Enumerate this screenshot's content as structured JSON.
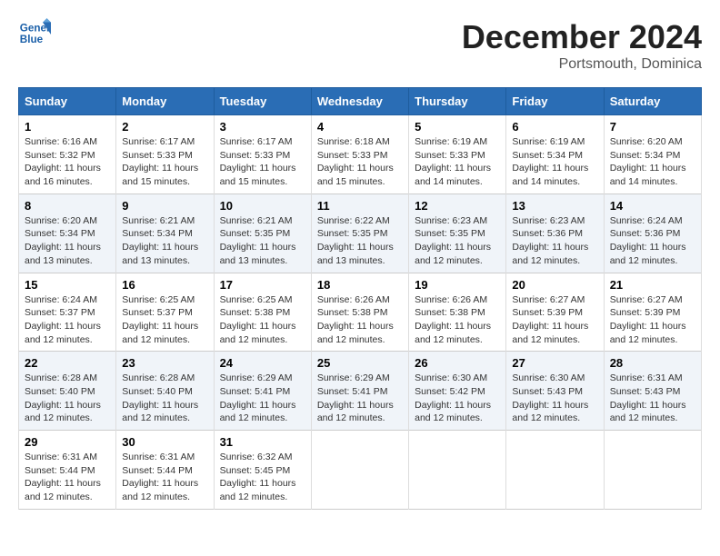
{
  "header": {
    "logo_line1": "General",
    "logo_line2": "Blue",
    "month": "December 2024",
    "location": "Portsmouth, Dominica"
  },
  "weekdays": [
    "Sunday",
    "Monday",
    "Tuesday",
    "Wednesday",
    "Thursday",
    "Friday",
    "Saturday"
  ],
  "weeks": [
    [
      {
        "day": 1,
        "sunrise": "6:16 AM",
        "sunset": "5:32 PM",
        "daylight": "11 hours and 16 minutes."
      },
      {
        "day": 2,
        "sunrise": "6:17 AM",
        "sunset": "5:33 PM",
        "daylight": "11 hours and 15 minutes."
      },
      {
        "day": 3,
        "sunrise": "6:17 AM",
        "sunset": "5:33 PM",
        "daylight": "11 hours and 15 minutes."
      },
      {
        "day": 4,
        "sunrise": "6:18 AM",
        "sunset": "5:33 PM",
        "daylight": "11 hours and 15 minutes."
      },
      {
        "day": 5,
        "sunrise": "6:19 AM",
        "sunset": "5:33 PM",
        "daylight": "11 hours and 14 minutes."
      },
      {
        "day": 6,
        "sunrise": "6:19 AM",
        "sunset": "5:34 PM",
        "daylight": "11 hours and 14 minutes."
      },
      {
        "day": 7,
        "sunrise": "6:20 AM",
        "sunset": "5:34 PM",
        "daylight": "11 hours and 14 minutes."
      }
    ],
    [
      {
        "day": 8,
        "sunrise": "6:20 AM",
        "sunset": "5:34 PM",
        "daylight": "11 hours and 13 minutes."
      },
      {
        "day": 9,
        "sunrise": "6:21 AM",
        "sunset": "5:34 PM",
        "daylight": "11 hours and 13 minutes."
      },
      {
        "day": 10,
        "sunrise": "6:21 AM",
        "sunset": "5:35 PM",
        "daylight": "11 hours and 13 minutes."
      },
      {
        "day": 11,
        "sunrise": "6:22 AM",
        "sunset": "5:35 PM",
        "daylight": "11 hours and 13 minutes."
      },
      {
        "day": 12,
        "sunrise": "6:23 AM",
        "sunset": "5:35 PM",
        "daylight": "11 hours and 12 minutes."
      },
      {
        "day": 13,
        "sunrise": "6:23 AM",
        "sunset": "5:36 PM",
        "daylight": "11 hours and 12 minutes."
      },
      {
        "day": 14,
        "sunrise": "6:24 AM",
        "sunset": "5:36 PM",
        "daylight": "11 hours and 12 minutes."
      }
    ],
    [
      {
        "day": 15,
        "sunrise": "6:24 AM",
        "sunset": "5:37 PM",
        "daylight": "11 hours and 12 minutes."
      },
      {
        "day": 16,
        "sunrise": "6:25 AM",
        "sunset": "5:37 PM",
        "daylight": "11 hours and 12 minutes."
      },
      {
        "day": 17,
        "sunrise": "6:25 AM",
        "sunset": "5:38 PM",
        "daylight": "11 hours and 12 minutes."
      },
      {
        "day": 18,
        "sunrise": "6:26 AM",
        "sunset": "5:38 PM",
        "daylight": "11 hours and 12 minutes."
      },
      {
        "day": 19,
        "sunrise": "6:26 AM",
        "sunset": "5:38 PM",
        "daylight": "11 hours and 12 minutes."
      },
      {
        "day": 20,
        "sunrise": "6:27 AM",
        "sunset": "5:39 PM",
        "daylight": "11 hours and 12 minutes."
      },
      {
        "day": 21,
        "sunrise": "6:27 AM",
        "sunset": "5:39 PM",
        "daylight": "11 hours and 12 minutes."
      }
    ],
    [
      {
        "day": 22,
        "sunrise": "6:28 AM",
        "sunset": "5:40 PM",
        "daylight": "11 hours and 12 minutes."
      },
      {
        "day": 23,
        "sunrise": "6:28 AM",
        "sunset": "5:40 PM",
        "daylight": "11 hours and 12 minutes."
      },
      {
        "day": 24,
        "sunrise": "6:29 AM",
        "sunset": "5:41 PM",
        "daylight": "11 hours and 12 minutes."
      },
      {
        "day": 25,
        "sunrise": "6:29 AM",
        "sunset": "5:41 PM",
        "daylight": "11 hours and 12 minutes."
      },
      {
        "day": 26,
        "sunrise": "6:30 AM",
        "sunset": "5:42 PM",
        "daylight": "11 hours and 12 minutes."
      },
      {
        "day": 27,
        "sunrise": "6:30 AM",
        "sunset": "5:43 PM",
        "daylight": "11 hours and 12 minutes."
      },
      {
        "day": 28,
        "sunrise": "6:31 AM",
        "sunset": "5:43 PM",
        "daylight": "11 hours and 12 minutes."
      }
    ],
    [
      {
        "day": 29,
        "sunrise": "6:31 AM",
        "sunset": "5:44 PM",
        "daylight": "11 hours and 12 minutes."
      },
      {
        "day": 30,
        "sunrise": "6:31 AM",
        "sunset": "5:44 PM",
        "daylight": "11 hours and 12 minutes."
      },
      {
        "day": 31,
        "sunrise": "6:32 AM",
        "sunset": "5:45 PM",
        "daylight": "11 hours and 12 minutes."
      },
      null,
      null,
      null,
      null
    ]
  ],
  "labels": {
    "sunrise": "Sunrise:",
    "sunset": "Sunset:",
    "daylight": "Daylight:"
  }
}
